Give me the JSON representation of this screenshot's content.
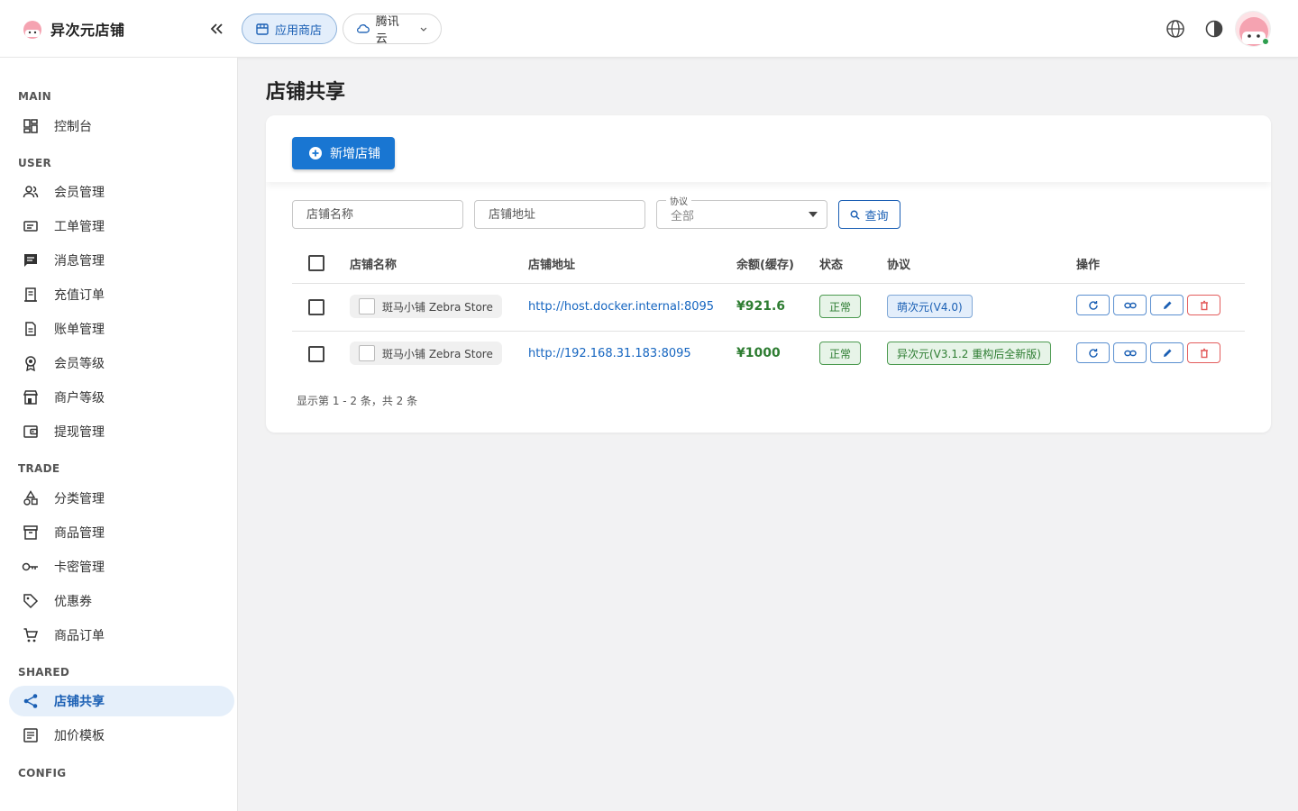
{
  "app": {
    "title": "异次元店铺"
  },
  "header": {
    "store_label": "应用商店",
    "cloud_label": "腾讯云"
  },
  "sidebar": {
    "sections": {
      "main": "MAIN",
      "user": "USER",
      "trade": "TRADE",
      "shared": "SHARED",
      "config": "CONFIG"
    },
    "items": [
      {
        "label": "控制台",
        "icon": "dashboard-icon"
      },
      {
        "label": "会员管理",
        "icon": "people-icon"
      },
      {
        "label": "工单管理",
        "icon": "ticket-icon"
      },
      {
        "label": "消息管理",
        "icon": "message-icon"
      },
      {
        "label": "充值订单",
        "icon": "receipt-icon"
      },
      {
        "label": "账单管理",
        "icon": "document-icon"
      },
      {
        "label": "会员等级",
        "icon": "medal-icon"
      },
      {
        "label": "商户等级",
        "icon": "storefront-icon"
      },
      {
        "label": "提现管理",
        "icon": "wallet-icon"
      },
      {
        "label": "分类管理",
        "icon": "category-icon"
      },
      {
        "label": "商品管理",
        "icon": "archive-icon"
      },
      {
        "label": "卡密管理",
        "icon": "key-icon"
      },
      {
        "label": "优惠券",
        "icon": "tag-icon"
      },
      {
        "label": "商品订单",
        "icon": "cart-icon"
      },
      {
        "label": "店铺共享",
        "icon": "share-icon"
      },
      {
        "label": "加价模板",
        "icon": "template-icon"
      }
    ],
    "active": "店铺共享"
  },
  "page": {
    "title": "店铺共享",
    "add_button": "新增店铺",
    "filters": {
      "name_placeholder": "店铺名称",
      "url_placeholder": "店铺地址",
      "protocol_label": "协议",
      "protocol_value": "全部",
      "query_button": "查询"
    },
    "table": {
      "columns": [
        "店铺名称",
        "店铺地址",
        "余额(缓存)",
        "状态",
        "协议",
        "操作"
      ],
      "rows": [
        {
          "name": "斑马小铺 Zebra Store",
          "url": "http://host.docker.internal:8095",
          "balance": "¥921.6",
          "status": "正常",
          "protocol": "萌次元(V4.0)"
        },
        {
          "name": "斑马小铺 Zebra Store",
          "url": "http://192.168.31.183:8095",
          "balance": "¥1000",
          "status": "正常",
          "protocol": "异次元(V3.1.2 重构后全新版)"
        }
      ]
    },
    "footer": "显示第 1 - 2 条，共 2 条"
  },
  "colors": {
    "primary": "#1976d2",
    "active_bg": "#e5effa",
    "success": "#2e7d32",
    "danger": "#e35d5d"
  }
}
